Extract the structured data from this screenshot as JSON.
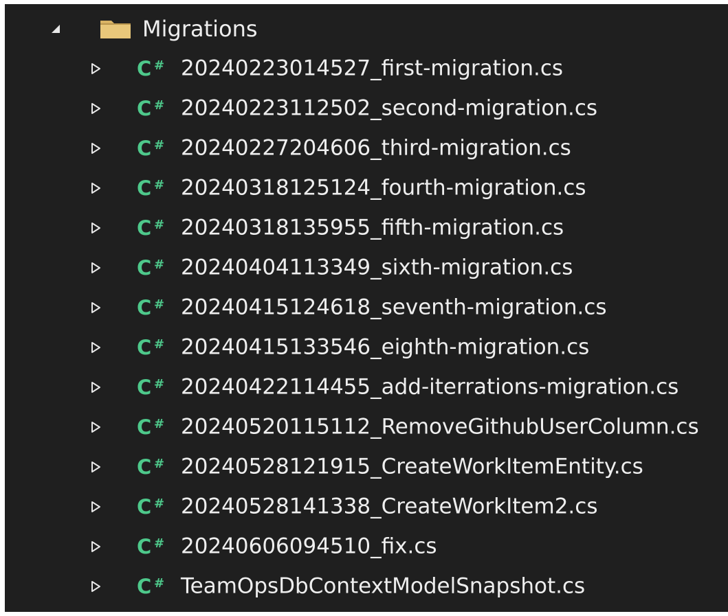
{
  "colors": {
    "panel_background": "#1f1f1f",
    "text": "#eeeeee",
    "csharp_icon": "#4ec98b",
    "folder_icon": "#d9b465",
    "expander": "#e8e8e8"
  },
  "tree": {
    "folder": {
      "label": "Migrations",
      "icon": "folder-icon",
      "expanded": true
    },
    "files": [
      {
        "label": "20240223014527_first-migration.cs",
        "icon": "csharp-file-icon"
      },
      {
        "label": "20240223112502_second-migration.cs",
        "icon": "csharp-file-icon"
      },
      {
        "label": "20240227204606_third-migration.cs",
        "icon": "csharp-file-icon"
      },
      {
        "label": "20240318125124_fourth-migration.cs",
        "icon": "csharp-file-icon"
      },
      {
        "label": "20240318135955_fifth-migration.cs",
        "icon": "csharp-file-icon"
      },
      {
        "label": "20240404113349_sixth-migration.cs",
        "icon": "csharp-file-icon"
      },
      {
        "label": "20240415124618_seventh-migration.cs",
        "icon": "csharp-file-icon"
      },
      {
        "label": "20240415133546_eighth-migration.cs",
        "icon": "csharp-file-icon"
      },
      {
        "label": "20240422114455_add-iterrations-migration.cs",
        "icon": "csharp-file-icon"
      },
      {
        "label": "20240520115112_RemoveGithubUserColumn.cs",
        "icon": "csharp-file-icon"
      },
      {
        "label": "20240528121915_CreateWorkItemEntity.cs",
        "icon": "csharp-file-icon"
      },
      {
        "label": "20240528141338_CreateWorkItem2.cs",
        "icon": "csharp-file-icon"
      },
      {
        "label": "20240606094510_fix.cs",
        "icon": "csharp-file-icon"
      },
      {
        "label": "TeamOpsDbContextModelSnapshot.cs",
        "icon": "csharp-file-icon"
      }
    ],
    "file_icon_text": {
      "letter": "C",
      "symbol": "#"
    }
  }
}
